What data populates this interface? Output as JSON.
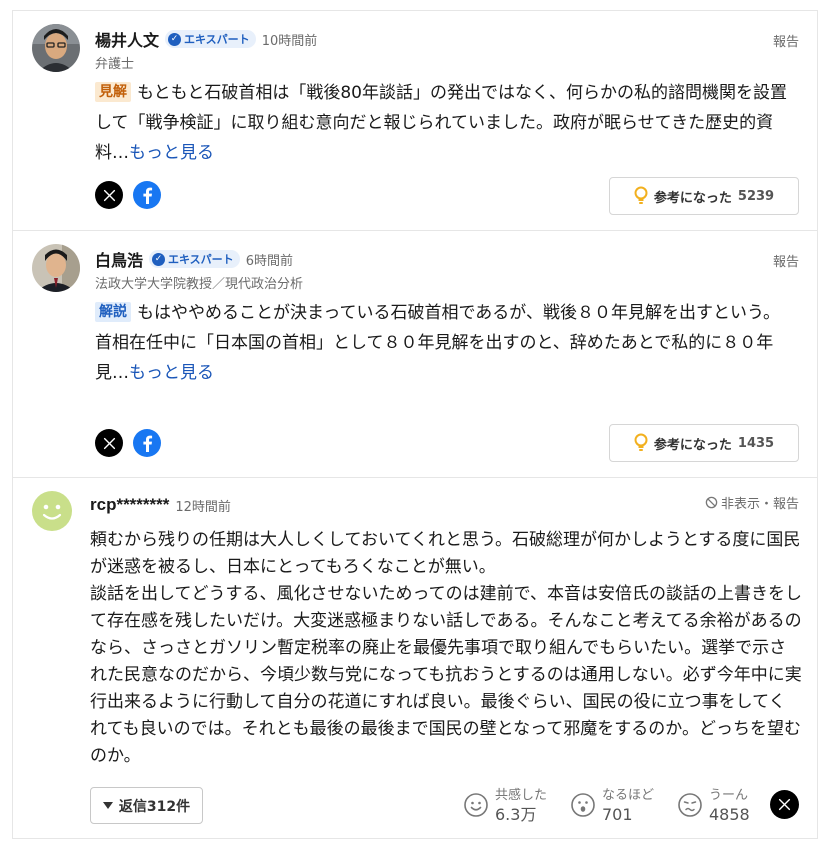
{
  "comments": [
    {
      "name": "楊井人文",
      "badge": "エキスパート",
      "time": "10時間前",
      "profile": "弁護士",
      "report": "報告",
      "tag": "見解",
      "text": "もともと石破首相は「戦後80年談話」の発出ではなく、何らかの私的諮問機関を設置して「戦争検証」に取り組む意向だと報じられていました。政府が眠らせてきた歴史的資料…",
      "more": "もっと見る",
      "helpful_label": "参考になった",
      "helpful_count": "5239"
    },
    {
      "name": "白鳥浩",
      "badge": "エキスパート",
      "time": "6時間前",
      "profile": "法政大学大学院教授／現代政治分析",
      "report": "報告",
      "tag": "解説",
      "text_line1": "もはややめることが決まっている石破首相であるが、戦後８０年見解を出すという。",
      "text_line2": "首相在任中に「日本国の首相」として８０年見解を出すのと、辞めたあとで私的に８０年見…",
      "more": "もっと見る",
      "helpful_label": "参考になった",
      "helpful_count": "1435"
    }
  ],
  "user_comment": {
    "name": "rcp********",
    "time": "12時間前",
    "hide_report": "非表示・報告",
    "paragraph1": "頼むから残りの任期は大人しくしておいてくれと思う。石破総理が何かしようとする度に国民が迷惑を被るし、日本にとってもろくなことが無い。",
    "paragraph2": "談話を出してどうする、風化させないためってのは建前で、本音は安倍氏の談話の上書きをして存在感を残したいだけ。大変迷惑極まりない話しである。そんなこと考えてる余裕があるのなら、さっさとガソリン暫定税率の廃止を最優先事項で取り組んでもらいたい。選挙で示された民意なのだから、今頃少数与党になっても抗おうとするのは通用しない。必ず今年中に実行出来るように行動して自分の花道にすれば良い。最後ぐらい、国民の役に立つ事をしてくれても良いのでは。それとも最後の最後まで国民の壁となって邪魔をするのか。どっちを望むのか。",
    "reply_label": "返信",
    "reply_count": "312件",
    "reactions": [
      {
        "label": "共感した",
        "count": "6.3万"
      },
      {
        "label": "なるほど",
        "count": "701"
      },
      {
        "label": "うーん",
        "count": "4858"
      }
    ]
  },
  "colors": {
    "accent_link": "#1a56b8",
    "expert_badge": "#1f5fbf",
    "kenkai_tag_bg": "#fbe9d0",
    "kaisetsu_tag_bg": "#e0ecfb",
    "lightbulb": "#f2b01e"
  },
  "icons": [
    "x-logo-icon",
    "facebook-icon",
    "lightbulb-icon",
    "check-badge-icon",
    "hide-icon",
    "smile-face-icon",
    "surprised-face-icon",
    "confused-face-icon",
    "triangle-down-icon"
  ]
}
